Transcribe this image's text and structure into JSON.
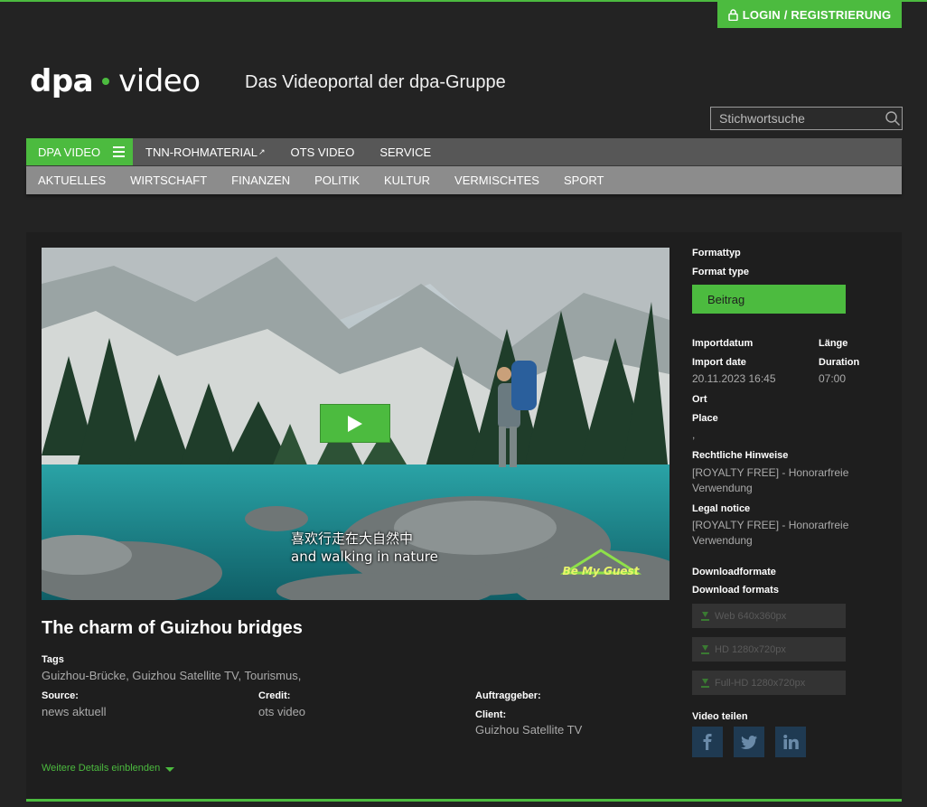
{
  "header": {
    "login_label": "LOGIN / REGISTRIERUNG",
    "logo_left": "dpa",
    "logo_right": "video",
    "tagline": "Das Videoportal der dpa-Gruppe",
    "search_placeholder": "Stichwortsuche"
  },
  "nav_main": [
    {
      "label": "DPA VIDEO"
    },
    {
      "label": "TNN-ROHMATERIAL"
    },
    {
      "label": "OTS VIDEO"
    },
    {
      "label": "SERVICE"
    }
  ],
  "nav_sub": [
    {
      "label": "AKTUELLES"
    },
    {
      "label": "WIRTSCHAFT"
    },
    {
      "label": "FINANZEN"
    },
    {
      "label": "POLITIK"
    },
    {
      "label": "KULTUR"
    },
    {
      "label": "VERMISCHTES"
    },
    {
      "label": "SPORT"
    }
  ],
  "video": {
    "subtitle_line1": "喜欢行走在大自然中",
    "subtitle_line2": "and walking in nature",
    "badge_text": "Be My Guest",
    "title": "The charm of Guizhou bridges"
  },
  "details": {
    "tags_label": "Tags",
    "tags_value": "Guizhou-Brücke, Guizhou Satellite TV, Tourismus,",
    "source_label": "Source:",
    "source_value": "news aktuell",
    "credit_label": "Credit:",
    "credit_value": "ots video",
    "auftraggeber_label": "Auftraggeber:",
    "client_label": "Client:",
    "client_value": "Guizhou Satellite TV",
    "more_label": "Weitere Details einblenden"
  },
  "sidebar": {
    "formattyp_label": "Formattyp",
    "format_type_label": "Format type",
    "format_value": "Beitrag",
    "importdatum_label": "Importdatum",
    "import_date_label": "Import date",
    "import_date_value": "20.11.2023 16:45",
    "laenge_label": "Länge",
    "duration_label": "Duration",
    "duration_value": "07:00",
    "ort_label": "Ort",
    "place_label": "Place",
    "place_value": ",",
    "rechtliche_label": "Rechtliche Hinweise",
    "rechtliche_value": "[ROYALTY FREE] - Honorarfreie Verwendung",
    "legal_label": "Legal notice",
    "legal_value": "[ROYALTY FREE] - Honorarfreie Verwendung",
    "downloadformate_label": "Downloadformate",
    "download_formats_label": "Download formats",
    "downloads": [
      {
        "label": "Web 640x360px"
      },
      {
        "label": "HD 1280x720px"
      },
      {
        "label": "Full-HD 1280x720px"
      }
    ],
    "share_label": "Video teilen"
  },
  "colors": {
    "accent": "#4cbb3f",
    "background": "#232323",
    "panel": "#1e1e1e"
  }
}
